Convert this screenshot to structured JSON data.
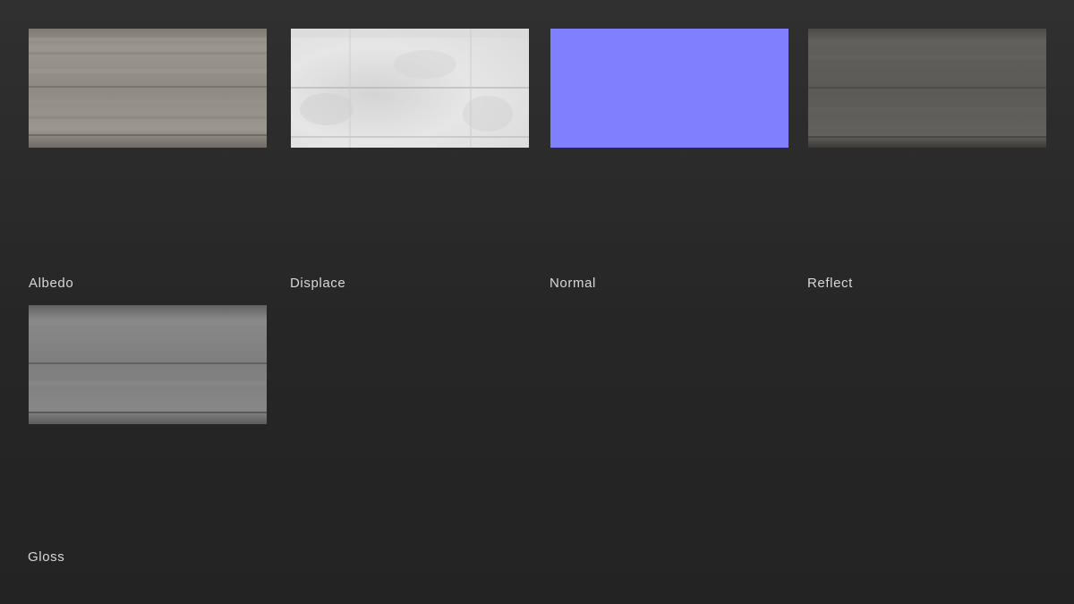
{
  "maps": [
    {
      "label": "Albedo",
      "icon": "albedo-texture",
      "base_color": "#8e8a82"
    },
    {
      "label": "Displace",
      "icon": "displacement-texture",
      "base_color": "#e2e2e2"
    },
    {
      "label": "Normal",
      "icon": "normal-map-texture",
      "base_color": "#8080ff"
    },
    {
      "label": "Reflect",
      "icon": "reflection-texture",
      "base_color": "#5e5c58"
    },
    {
      "label": "Gloss",
      "icon": "gloss-texture",
      "base_color": "#7f7f7f"
    }
  ]
}
